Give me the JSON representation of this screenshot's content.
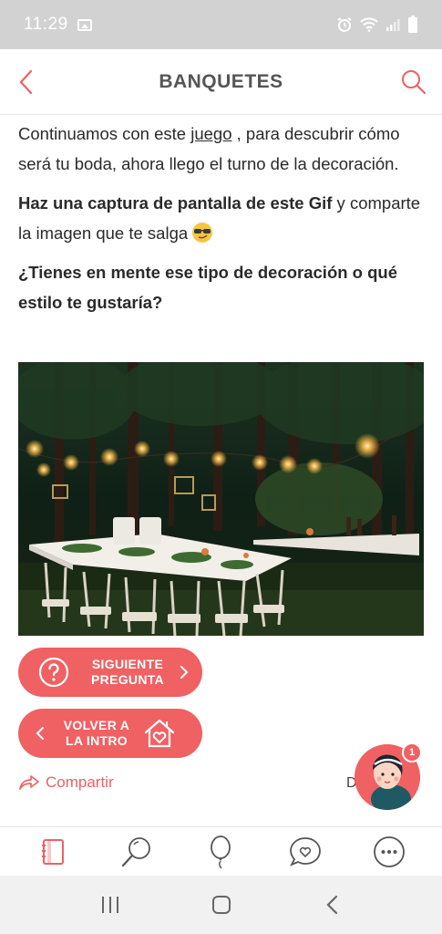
{
  "status_bar": {
    "time": "11:29",
    "icons": [
      "gallery-icon",
      "alarm-icon",
      "wifi-icon",
      "signal-icon",
      "battery-icon"
    ]
  },
  "app_bar": {
    "title": "BANQUETES",
    "back_icon": "chevron-left-icon",
    "search_icon": "search-icon"
  },
  "article": {
    "p1_before": "Continuamos con este ",
    "p1_link": "juego",
    "p1_after": " , para descubrir cómo será tu boda, ahora llego el turno de la decoración.",
    "p2_bold_a": "Haz una captura de pantalla de este ",
    "p2_bold_b": "Gif",
    "p2_rest": " y comparte la imagen que te salga",
    "p2_emoji": "sunglasses-emoji",
    "p3": "¿Tienes en mente ese tipo de decoración o qué estilo te gustaría?"
  },
  "buttons": {
    "next_line1": "SIGUIENTE",
    "next_line2": "PREGUNTA",
    "back_line1": "VOLVER A",
    "back_line2": "LA INTRO"
  },
  "share": {
    "label": "Compartir",
    "partial_text": "D"
  },
  "assistant": {
    "badge_count": "1"
  },
  "tabs": [
    "notebook-icon",
    "search-icon",
    "balloon-icon",
    "chat-heart-icon",
    "more-icon"
  ],
  "colors": {
    "accent": "#ef6163",
    "status_bar": "#d2d2d2",
    "title_text": "#555555"
  }
}
